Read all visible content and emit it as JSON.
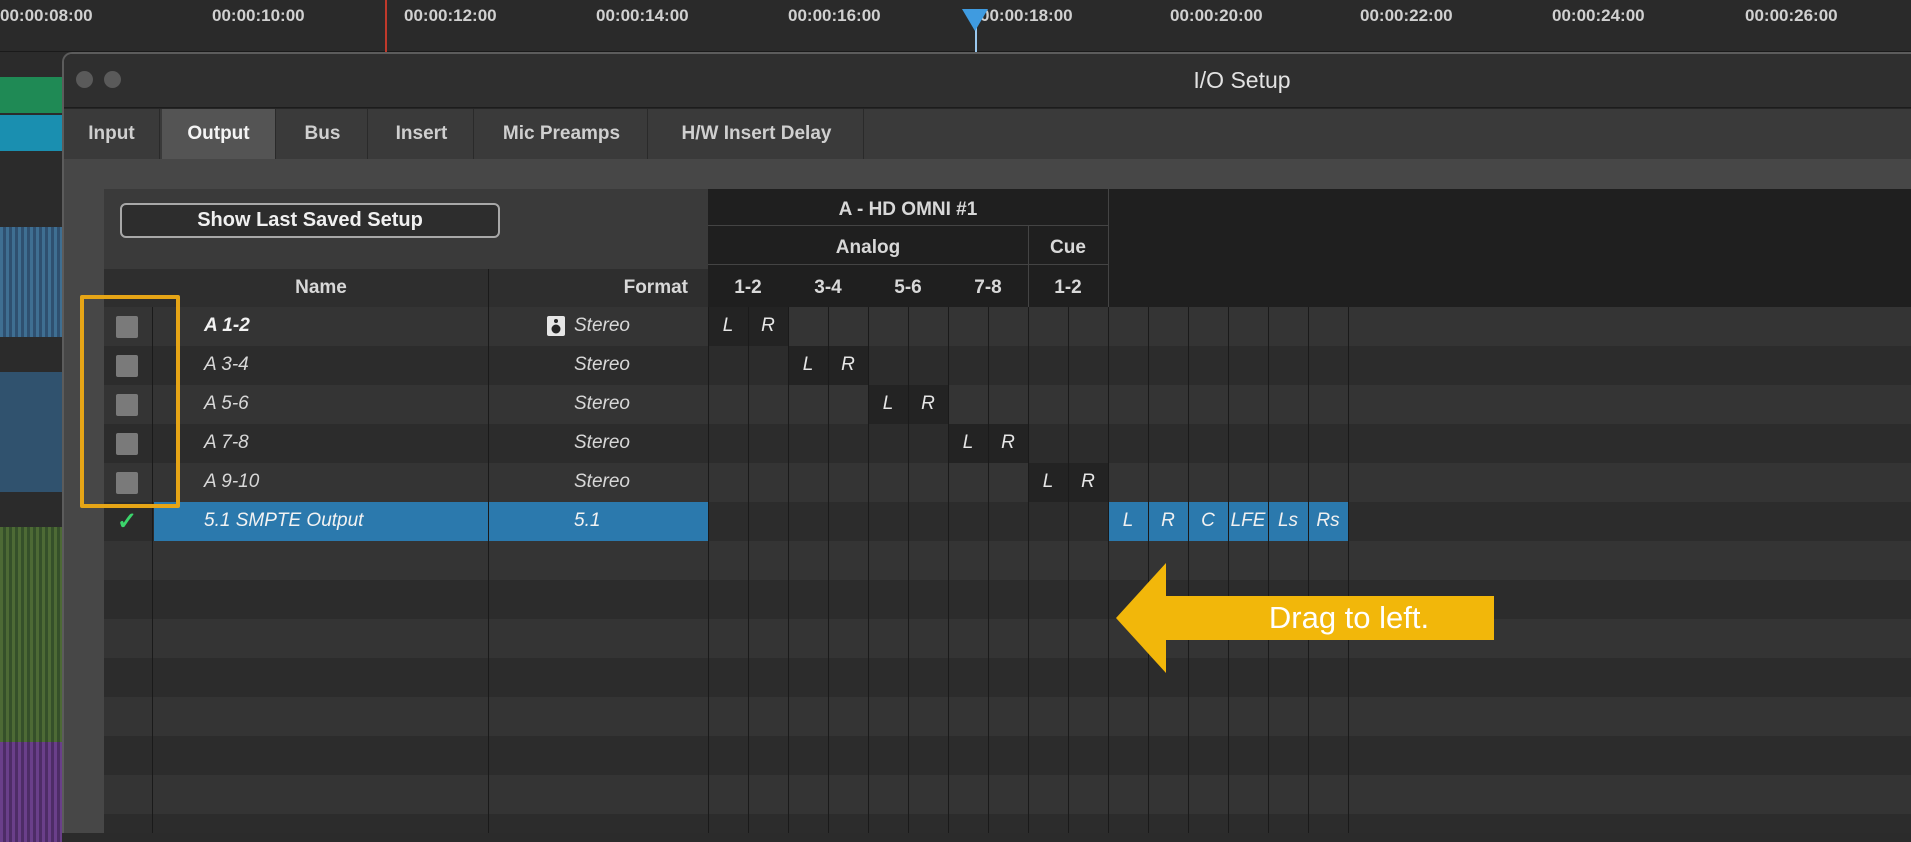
{
  "ruler": {
    "timecodes": [
      "00:00:08:00",
      "00:00:10:00",
      "00:00:12:00",
      "00:00:14:00",
      "00:00:16:00",
      "00:00:18:00",
      "00:00:20:00",
      "00:00:22:00",
      "00:00:24:00",
      "00:00:26:00"
    ]
  },
  "window": {
    "title": "I/O Setup"
  },
  "tabs": [
    "Input",
    "Output",
    "Bus",
    "Insert",
    "Mic Preamps",
    "H/W Insert Delay"
  ],
  "active_tab": "Output",
  "toolbar": {
    "show_last_saved_label": "Show Last Saved Setup"
  },
  "headers": {
    "device": "A - HD OMNI #1",
    "group_analog": "Analog",
    "group_cue": "Cue",
    "col_name": "Name",
    "col_format": "Format",
    "pairs": [
      "1-2",
      "3-4",
      "5-6",
      "7-8",
      "1-2"
    ]
  },
  "rows": [
    {
      "name": "A 1-2",
      "format": "Stereo",
      "checked": false,
      "channels": [
        "L",
        "R"
      ],
      "speaker_icon": "speaker-icon"
    },
    {
      "name": "A 3-4",
      "format": "Stereo",
      "checked": false,
      "channels": [
        "L",
        "R"
      ]
    },
    {
      "name": "A 5-6",
      "format": "Stereo",
      "checked": false,
      "channels": [
        "L",
        "R"
      ]
    },
    {
      "name": "A 7-8",
      "format": "Stereo",
      "checked": false,
      "channels": [
        "L",
        "R"
      ]
    },
    {
      "name": "A 9-10",
      "format": "Stereo",
      "checked": false,
      "channels": [
        "L",
        "R"
      ]
    },
    {
      "name": "5.1 SMPTE Output",
      "format": "5.1",
      "checked": true,
      "check_glyph": "✓",
      "channels": [
        "L",
        "R",
        "C",
        "LFE",
        "Ls",
        "Rs"
      ]
    }
  ],
  "annotation": {
    "text": "Drag to left.",
    "color": "#f2b70a"
  },
  "colors": {
    "selection": "#2b79ad",
    "highlight_box": "#e6a516",
    "check": "#3bd46b"
  }
}
